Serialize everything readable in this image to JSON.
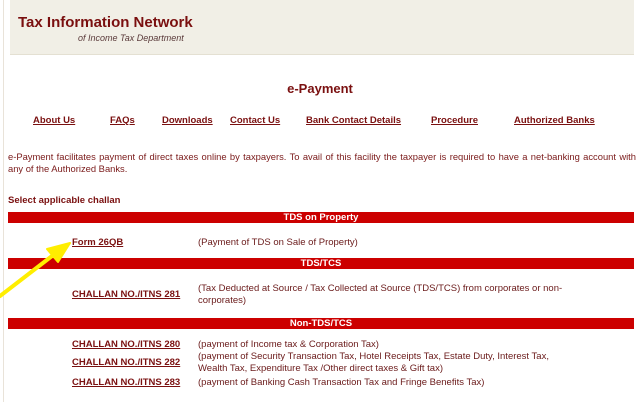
{
  "header": {
    "title": "Tax Information Network",
    "subtitle": "of Income Tax Department"
  },
  "page_title": "e-Payment",
  "nav": [
    {
      "label": "About Us"
    },
    {
      "label": "FAQs"
    },
    {
      "label": "Downloads"
    },
    {
      "label": "Contact Us"
    },
    {
      "label": "Bank Contact Details"
    },
    {
      "label": "Procedure"
    },
    {
      "label": "Authorized Banks"
    }
  ],
  "intro": "e-Payment facilitates payment of direct taxes online by taxpayers. To avail of this facility the taxpayer is required to have a net-banking account with any of the Authorized Banks.",
  "select_label": "Select applicable challan",
  "sections": [
    {
      "title": "TDS on Property",
      "items": [
        {
          "link": "Form 26QB",
          "desc": "(Payment of TDS on Sale of Property)"
        }
      ]
    },
    {
      "title": "TDS/TCS",
      "items": [
        {
          "link": "CHALLAN NO./ITNS 281",
          "desc": "(Tax Deducted at Source / Tax Collected at Source (TDS/TCS) from corporates or non-corporates)"
        }
      ]
    },
    {
      "title": "Non-TDS/TCS",
      "items": [
        {
          "link": "CHALLAN NO./ITNS 280",
          "desc": "(payment of Income tax & Corporation Tax)"
        },
        {
          "link": "CHALLAN NO./ITNS 282",
          "desc": "(payment of Security Transaction Tax, Hotel Receipts Tax, Estate Duty, Interest Tax, Wealth Tax, Expenditure Tax /Other direct taxes & Gift tax)"
        },
        {
          "link": "CHALLAN NO./ITNS 283",
          "desc": "(payment of Banking Cash Transaction Tax and Fringe Benefits Tax)"
        }
      ]
    }
  ],
  "colors": {
    "accent": "#7a1010",
    "section_bar": "#cc0000",
    "header_bg": "#f1efe6",
    "arrow": "#ffee00"
  }
}
